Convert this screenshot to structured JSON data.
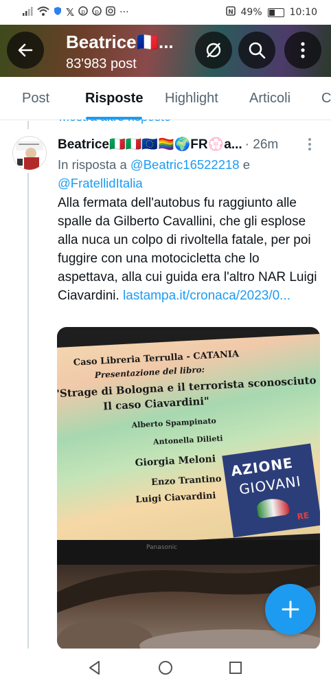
{
  "status_bar": {
    "battery": "49%",
    "battery_level": 0.49,
    "time": "10:10",
    "notification_icons": [
      "signal-icon",
      "wifi-icon",
      "shield-icon",
      "x-icon",
      "pinterest-icon",
      "pinterest-icon",
      "instagram-icon",
      "more-icon"
    ],
    "more": "···"
  },
  "header": {
    "title": "Beatrice🇫🇷...",
    "subtitle": "83'983 post",
    "colors": {
      "circle_button": "#0a0a0a"
    }
  },
  "tabs": [
    {
      "label": "Post",
      "active": false
    },
    {
      "label": "Risposte",
      "active": true
    },
    {
      "label": "Highlight",
      "active": false
    },
    {
      "label": "Articoli",
      "active": false
    },
    {
      "label": "C",
      "active": false
    }
  ],
  "thread": {
    "more_replies": "Mostra altre risposte"
  },
  "tweet": {
    "author": "Beatrice🇮🇹🇮🇹🇪🇺🏳️‍🌈🌍FR💮a...",
    "time": "· 26m",
    "reply_to_prefix": "In risposta a",
    "reply_to_user1": "@Beatric16522218",
    "reply_to_and": "e",
    "reply_to_user2": "@FratellidItalia",
    "text": "Alla fermata dell'autobus fu raggiunto alle spalle da Gilberto Cavallini, che gli esplose alla nuca un colpo di rivoltella fatale, per poi fuggire con una motocicletta che lo aspettava, alla cui guida era l'altro NAR Luigi Ciavardini.",
    "link": "lastampa.it/cronaca/2023/0..."
  },
  "media": {
    "screen_lines": [
      "Caso Libreria Terrulla - CATANIA",
      "Presentazione del libro:",
      "\"Strage di Bologna e il terrorista sconosciuto",
      "Il caso Ciavardini\"",
      "Alberto Spampinato",
      "Antonella Dilieti",
      "Giorgia Meloni",
      "Enzo Trantino",
      "Luigi Ciavardini"
    ],
    "poster_line1": "AZIONE",
    "poster_line2": "GIOVANI",
    "poster_small": "RE",
    "tv_brand": "Panasonic"
  },
  "fab": {
    "icon": "plus-icon",
    "color": "#1d9bf0"
  },
  "nav_bar": {
    "icons": [
      "back-triangle-icon",
      "home-circle-icon",
      "recents-square-icon"
    ]
  },
  "colors": {
    "accent": "#1d9bf0",
    "text": "#0f1419",
    "muted": "#536471"
  }
}
